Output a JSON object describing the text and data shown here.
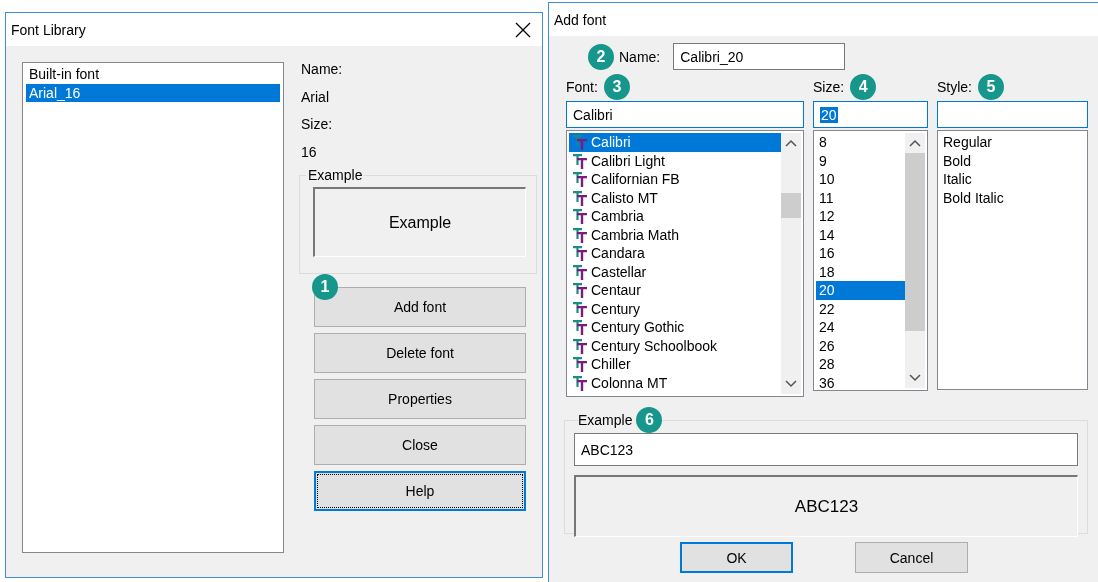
{
  "font_library": {
    "title": "Font Library",
    "fonts": [
      {
        "label": "Built-in font",
        "selected": false
      },
      {
        "label": "Arial_16",
        "selected": true
      }
    ],
    "name_label": "Name:",
    "name_value": "Arial",
    "size_label": "Size:",
    "size_value": "16",
    "example": {
      "legend": "Example",
      "preview": "Example"
    },
    "buttons": [
      {
        "label": "Add font",
        "focused": false,
        "badge": "1"
      },
      {
        "label": "Delete font",
        "focused": false
      },
      {
        "label": "Properties",
        "focused": false
      },
      {
        "label": "Close",
        "focused": false
      },
      {
        "label": "Help",
        "focused": true
      }
    ]
  },
  "add_font": {
    "title": "Add font",
    "name": {
      "badge": "2",
      "label": "Name:",
      "value": "Calibri_20"
    },
    "font": {
      "label": "Font:",
      "badge": "3",
      "value": "Calibri",
      "value_selected": false,
      "items": [
        {
          "label": "Calibri",
          "selected": true
        },
        {
          "label": "Calibri Light",
          "selected": false
        },
        {
          "label": "Californian FB",
          "selected": false
        },
        {
          "label": "Calisto MT",
          "selected": false
        },
        {
          "label": "Cambria",
          "selected": false
        },
        {
          "label": "Cambria Math",
          "selected": false
        },
        {
          "label": "Candara",
          "selected": false
        },
        {
          "label": "Castellar",
          "selected": false
        },
        {
          "label": "Centaur",
          "selected": false
        },
        {
          "label": "Century",
          "selected": false
        },
        {
          "label": "Century Gothic",
          "selected": false
        },
        {
          "label": "Century Schoolbook",
          "selected": false
        },
        {
          "label": "Chiller",
          "selected": false
        },
        {
          "label": "Colonna MT",
          "selected": false
        }
      ]
    },
    "size": {
      "label": "Size:",
      "badge": "4",
      "value": "20",
      "value_selected": true,
      "items": [
        {
          "label": "8",
          "selected": false
        },
        {
          "label": "9",
          "selected": false
        },
        {
          "label": "10",
          "selected": false
        },
        {
          "label": "11",
          "selected": false
        },
        {
          "label": "12",
          "selected": false
        },
        {
          "label": "14",
          "selected": false
        },
        {
          "label": "16",
          "selected": false
        },
        {
          "label": "18",
          "selected": false
        },
        {
          "label": "20",
          "selected": true
        },
        {
          "label": "22",
          "selected": false
        },
        {
          "label": "24",
          "selected": false
        },
        {
          "label": "26",
          "selected": false
        },
        {
          "label": "28",
          "selected": false
        },
        {
          "label": "36",
          "selected": false
        }
      ]
    },
    "style": {
      "label": "Style:",
      "badge": "5",
      "items": [
        {
          "label": "Regular",
          "selected": false
        },
        {
          "label": "Bold",
          "selected": false
        },
        {
          "label": "Italic",
          "selected": false
        },
        {
          "label": "Bold Italic",
          "selected": false
        }
      ]
    },
    "example": {
      "legend": "Example",
      "badge": "6",
      "value": "ABC123",
      "preview": "ABC123"
    },
    "buttons": [
      {
        "label": "OK",
        "focused": true
      },
      {
        "label": "Cancel",
        "focused": false
      }
    ]
  }
}
